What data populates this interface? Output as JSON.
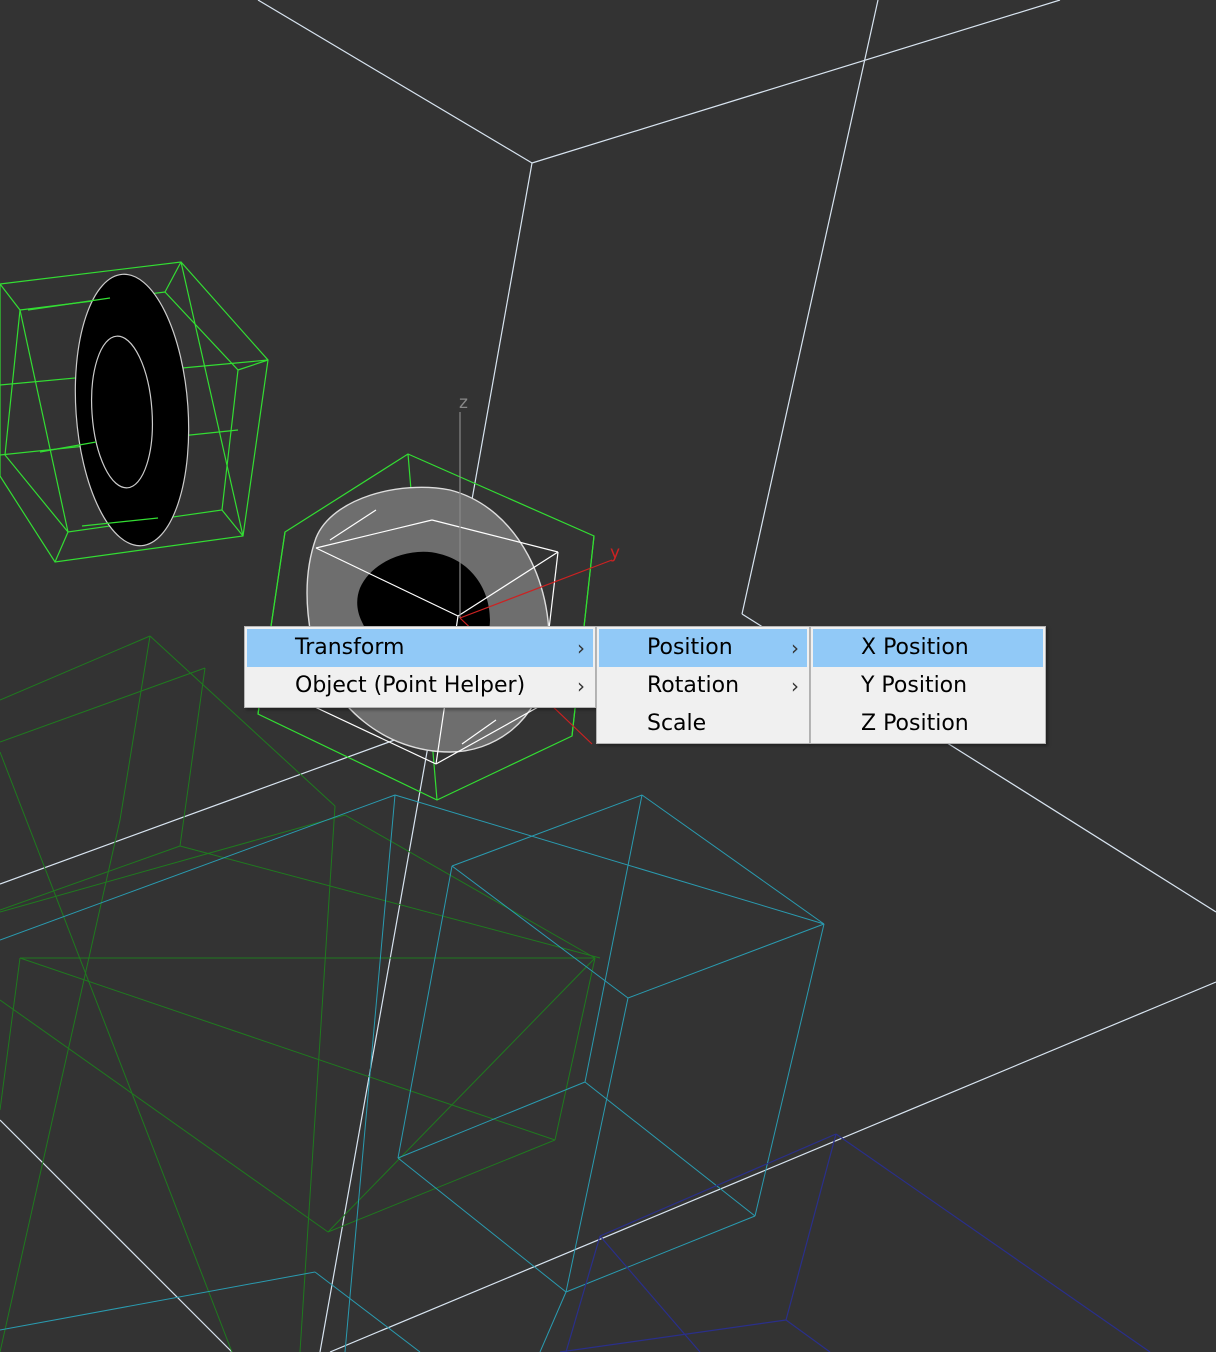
{
  "viewport": {
    "background": "#333333",
    "gizmo_axes": {
      "z": "z",
      "y": "y"
    },
    "colors": {
      "selected_wire": "#33dd33",
      "dim_green_wire": "#1f7a1f",
      "cyan_wire": "#2a9bb0",
      "blue_wire": "#2a2f8a",
      "white_wire": "#d8e4f0",
      "axis_z": "#888888",
      "axis_y": "#cc2222"
    }
  },
  "context_menu": {
    "root": {
      "items": [
        {
          "label": "Transform",
          "has_submenu": true,
          "active": true
        },
        {
          "label": "Object (Point Helper)",
          "has_submenu": true,
          "active": false
        }
      ]
    },
    "transform_submenu": {
      "items": [
        {
          "label": "Position",
          "has_submenu": true,
          "active": true
        },
        {
          "label": "Rotation",
          "has_submenu": true,
          "active": false
        },
        {
          "label": "Scale",
          "has_submenu": false,
          "active": false
        }
      ]
    },
    "position_submenu": {
      "items": [
        {
          "label": "X Position",
          "has_submenu": false,
          "active": true
        },
        {
          "label": "Y Position",
          "has_submenu": false,
          "active": false
        },
        {
          "label": "Z Position",
          "has_submenu": false,
          "active": false
        }
      ]
    },
    "submenu_icon": "chevron-right-icon",
    "highlight_color": "#91c9f7",
    "menu_background": "#f0f0f0"
  }
}
